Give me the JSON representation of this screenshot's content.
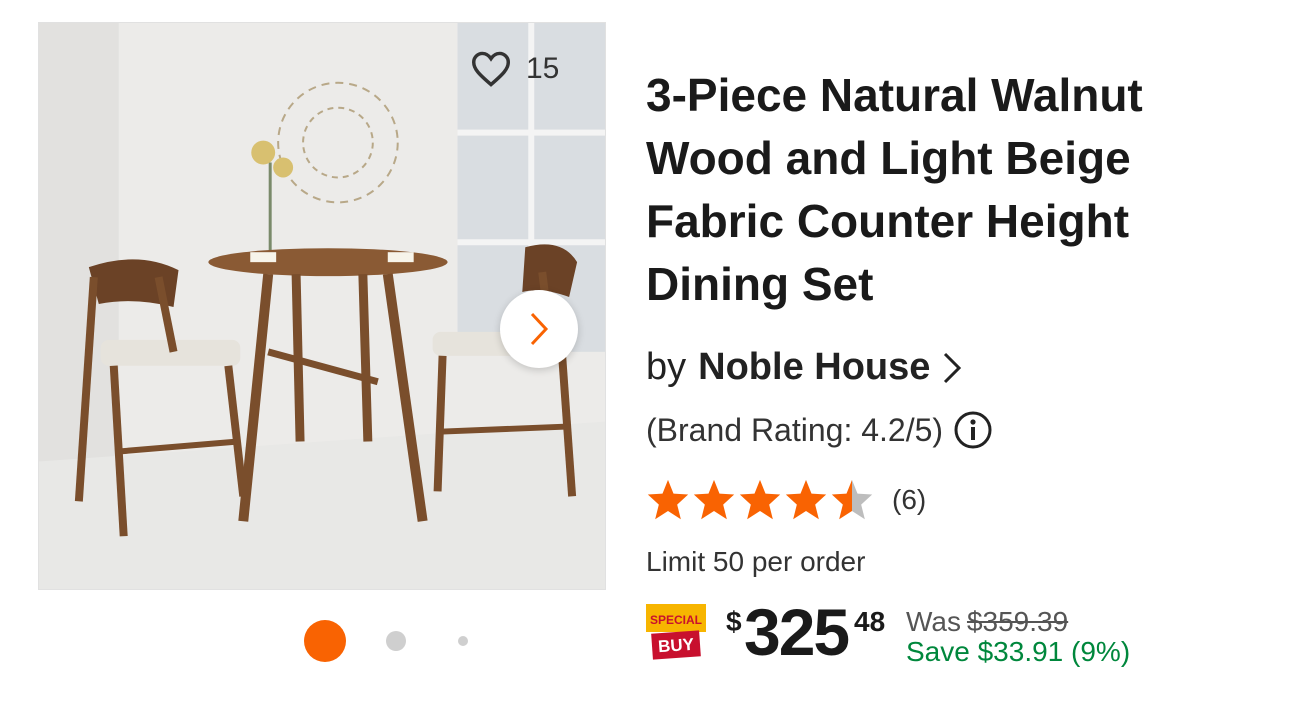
{
  "gallery": {
    "favorite_count": "15",
    "next_icon": "chevron-right-icon",
    "slides": 3,
    "active_slide": 1
  },
  "product": {
    "title": "3-Piece Natural Walnut Wood and Light Beige Fabric Counter Height Dining Set",
    "by_label": "by",
    "brand": "Noble House",
    "brand_rating": "(Brand Rating: 4.2/5)",
    "star_rating": 4.5,
    "review_count": "(6)",
    "limit": "Limit 50 per order"
  },
  "price": {
    "badge_top": "SPECIAL",
    "badge_bottom": "BUY",
    "currency": "$",
    "dollars": "325",
    "cents": "48",
    "was_label": "Was",
    "was_price": "$359.39",
    "save_text": "Save $33.91 (9%)"
  },
  "colors": {
    "accent": "#f96302",
    "save_green": "#00873c"
  }
}
